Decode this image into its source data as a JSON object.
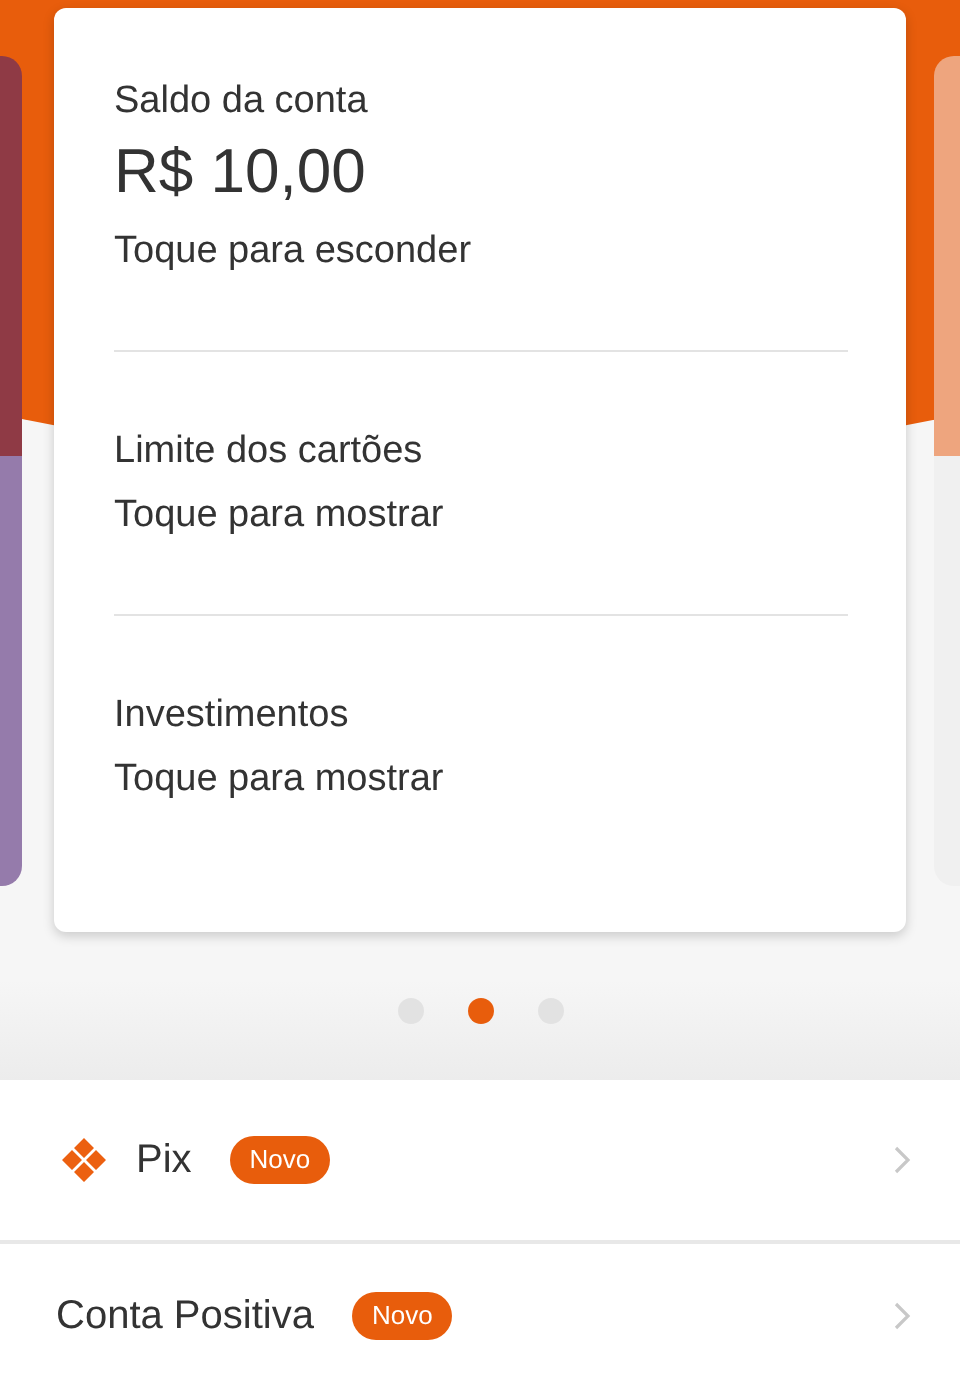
{
  "balance_card": {
    "sections": [
      {
        "label": "Saldo da conta",
        "value": "R$ 10,00",
        "action": "Toque para esconder"
      },
      {
        "label": "Limite dos cartões",
        "action": "Toque para mostrar"
      },
      {
        "label": "Investimentos",
        "action": "Toque para mostrar"
      }
    ]
  },
  "pager": [
    {
      "selected": false
    },
    {
      "selected": true
    },
    {
      "selected": false
    }
  ],
  "menu": [
    {
      "label": "Pix",
      "icon": true,
      "badge": "Novo"
    },
    {
      "label": "Conta Positiva",
      "icon": false,
      "badge": "Novo"
    }
  ]
}
